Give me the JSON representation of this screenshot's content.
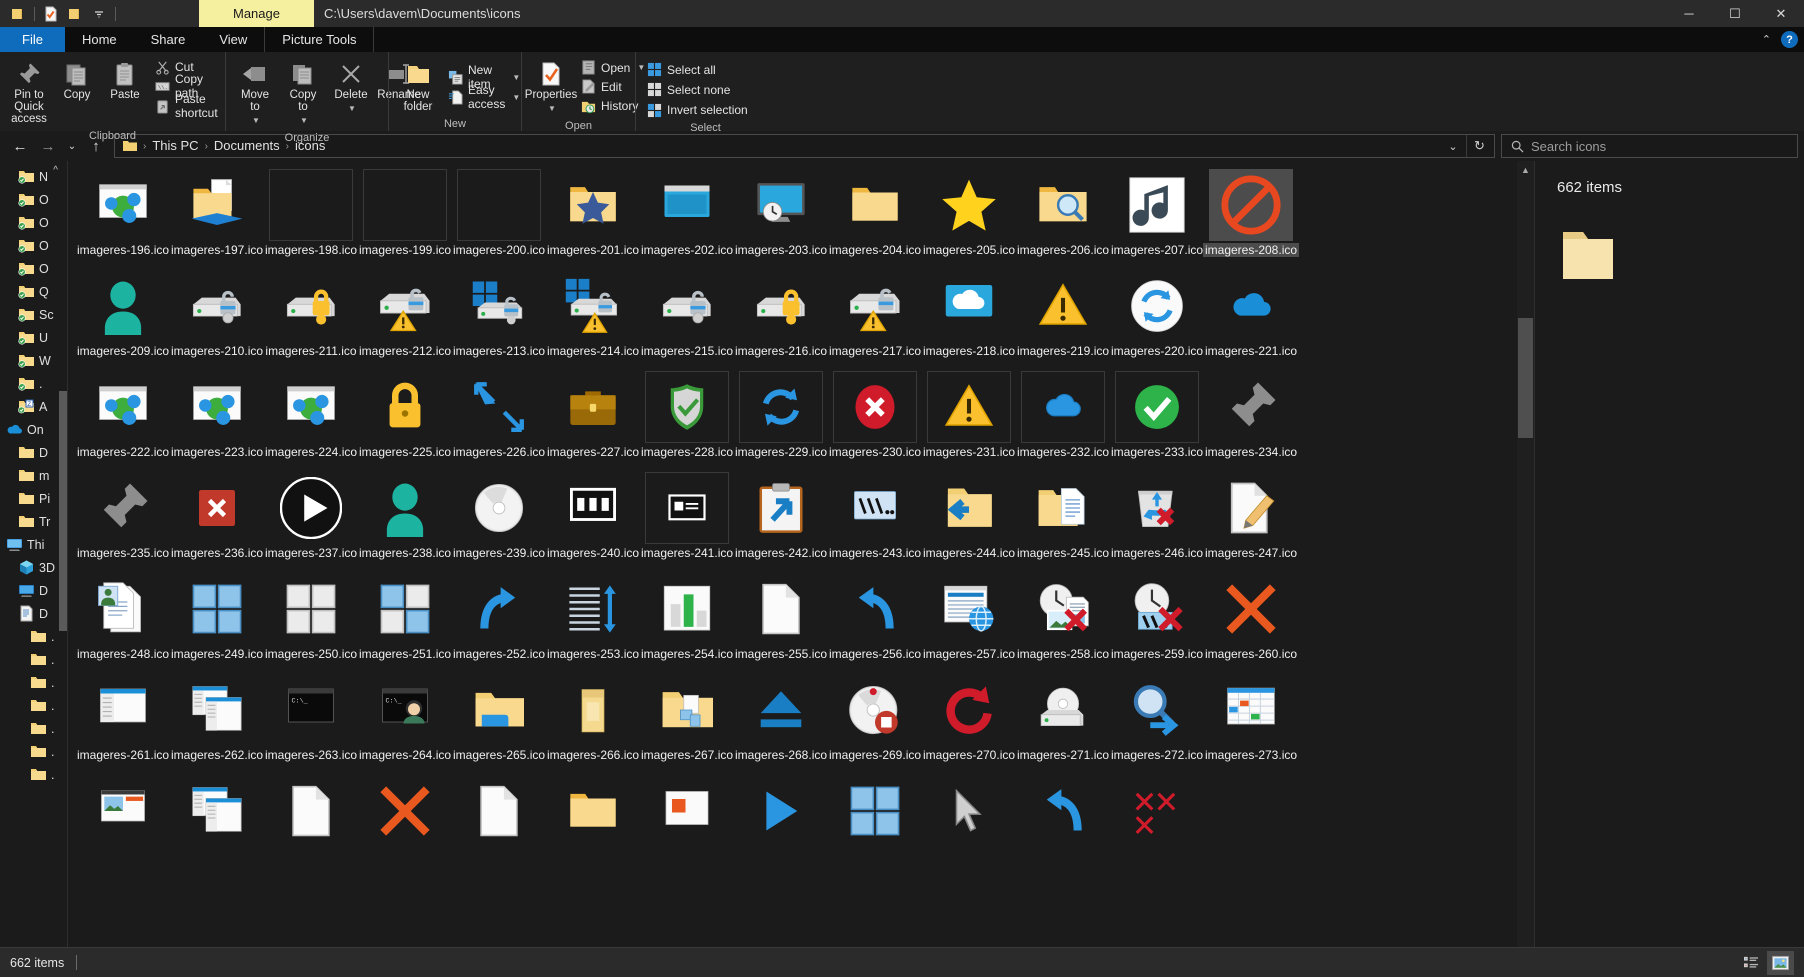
{
  "window": {
    "path_title": "C:\\Users\\davem\\Documents\\icons",
    "manage_tab": "Manage",
    "minimize": "─",
    "maximize": "☐",
    "close": "✕"
  },
  "quick_access": {
    "items": [
      {
        "name": "folder-icon",
        "label": ""
      },
      {
        "name": "properties-icon",
        "label": ""
      },
      {
        "name": "folder-icon",
        "label": ""
      },
      {
        "name": "chevron-down-icon",
        "label": ""
      }
    ]
  },
  "tabs": [
    {
      "id": "file",
      "label": "File"
    },
    {
      "id": "home",
      "label": "Home"
    },
    {
      "id": "share",
      "label": "Share"
    },
    {
      "id": "view",
      "label": "View"
    },
    {
      "id": "picture-tools",
      "label": "Picture Tools"
    }
  ],
  "ribbon": {
    "collapse_caret": "⌃",
    "help": "?",
    "groups": [
      {
        "label": "Clipboard",
        "big": [
          {
            "label": "Pin to Quick\naccess",
            "icon": "pin-icon"
          },
          {
            "label": "Copy",
            "icon": "copy-icon"
          },
          {
            "label": "Paste",
            "icon": "paste-icon"
          }
        ],
        "small": [
          {
            "label": "Cut",
            "icon": "scissors-icon"
          },
          {
            "label": "Copy path",
            "icon": "copy-path-icon"
          },
          {
            "label": "Paste shortcut",
            "icon": "paste-shortcut-icon"
          }
        ]
      },
      {
        "label": "Organize",
        "big": [
          {
            "label": "Move\nto",
            "icon": "move-to-icon",
            "dropdown": true
          },
          {
            "label": "Copy\nto",
            "icon": "copy-to-icon",
            "dropdown": true
          },
          {
            "label": "Delete",
            "icon": "delete-icon",
            "dropdown": true
          },
          {
            "label": "Rename",
            "icon": "rename-icon"
          }
        ],
        "small": []
      },
      {
        "label": "New",
        "big": [
          {
            "label": "New\nfolder",
            "icon": "new-folder-icon"
          }
        ],
        "small": [
          {
            "label": "New item",
            "icon": "new-item-icon",
            "dropdown": true
          },
          {
            "label": "Easy access",
            "icon": "easy-access-icon",
            "dropdown": true
          }
        ]
      },
      {
        "label": "Open",
        "big": [
          {
            "label": "Properties",
            "icon": "properties-icon",
            "dropdown": true
          }
        ],
        "small": [
          {
            "label": "Open",
            "icon": "open-icon",
            "dropdown": true
          },
          {
            "label": "Edit",
            "icon": "edit-icon"
          },
          {
            "label": "History",
            "icon": "history-icon"
          }
        ]
      },
      {
        "label": "Select",
        "big": [],
        "small": [
          {
            "label": "Select all",
            "icon": "select-all-icon"
          },
          {
            "label": "Select none",
            "icon": "select-none-icon"
          },
          {
            "label": "Invert selection",
            "icon": "invert-selection-icon"
          }
        ]
      }
    ]
  },
  "addressbar": {
    "back": "←",
    "forward": "→",
    "recent": "⌄",
    "up": "↑",
    "breadcrumbs": [
      "This PC",
      "Documents",
      "icons"
    ],
    "separator": "›",
    "history_caret": "⌄",
    "refresh": "↻"
  },
  "search": {
    "placeholder": "Search icons",
    "icon": "search-icon"
  },
  "nav_pane": {
    "items": [
      {
        "label": "N",
        "icon": "folder-sync-icon",
        "indent": 1
      },
      {
        "label": "O",
        "icon": "folder-sync-icon",
        "indent": 1
      },
      {
        "label": "O",
        "icon": "folder-sync-icon",
        "indent": 1
      },
      {
        "label": "O",
        "icon": "folder-sync-icon",
        "indent": 1
      },
      {
        "label": "O",
        "icon": "folder-sync-icon",
        "indent": 1
      },
      {
        "label": "Q",
        "icon": "folder-sync-icon",
        "indent": 1
      },
      {
        "label": "Sc",
        "icon": "folder-sync-icon",
        "indent": 1
      },
      {
        "label": "U",
        "icon": "folder-sync-icon",
        "indent": 1
      },
      {
        "label": "W",
        "icon": "folder-sync-icon",
        "indent": 1
      },
      {
        "label": ".",
        "icon": "folder-sync-icon",
        "indent": 1
      },
      {
        "label": "A",
        "icon": "zip-sync-icon",
        "indent": 1
      },
      {
        "label": "On",
        "icon": "onedrive-icon",
        "indent": 0
      },
      {
        "label": "D",
        "icon": "folder-icon",
        "indent": 1
      },
      {
        "label": "m",
        "icon": "folder-icon",
        "indent": 1
      },
      {
        "label": "Pi",
        "icon": "folder-icon",
        "indent": 1
      },
      {
        "label": "Tr",
        "icon": "folder-icon",
        "indent": 1
      },
      {
        "label": "Thi",
        "icon": "this-pc-icon",
        "indent": 0
      },
      {
        "label": "3D",
        "icon": "3d-objects-icon",
        "indent": 1
      },
      {
        "label": "D",
        "icon": "desktop-icon",
        "indent": 1
      },
      {
        "label": "D",
        "icon": "documents-icon",
        "indent": 1
      },
      {
        "label": ".",
        "icon": "folder-icon",
        "indent": 2
      },
      {
        "label": ".",
        "icon": "folder-icon",
        "indent": 2
      },
      {
        "label": ".",
        "icon": "folder-icon",
        "indent": 2
      },
      {
        "label": ".",
        "icon": "folder-icon",
        "indent": 2
      },
      {
        "label": ".",
        "icon": "folder-icon",
        "indent": 2
      },
      {
        "label": ".",
        "icon": "folder-icon",
        "indent": 2
      },
      {
        "label": ".",
        "icon": "folder-icon",
        "indent": 2
      }
    ]
  },
  "detail_pane": {
    "count_text": "662 items",
    "icon": "folder-icon"
  },
  "status_bar": {
    "count_text": "662 items",
    "details_view_icon": "details-view-icon",
    "large-icons_view_icon": "large-icons-view-icon"
  },
  "files": [
    {
      "name": "imageres-196.ico",
      "glyph": "window-people",
      "framed": false
    },
    {
      "name": "imageres-197.ico",
      "glyph": "folder-doc-share",
      "framed": false
    },
    {
      "name": "imageres-198.ico",
      "glyph": "blank",
      "framed": true
    },
    {
      "name": "imageres-199.ico",
      "glyph": "blank",
      "framed": true
    },
    {
      "name": "imageres-200.ico",
      "glyph": "blank",
      "framed": true
    },
    {
      "name": "imageres-201.ico",
      "glyph": "folder-star",
      "framed": false
    },
    {
      "name": "imageres-202.ico",
      "glyph": "window-blue",
      "framed": false
    },
    {
      "name": "imageres-203.ico",
      "glyph": "monitor-clock",
      "framed": false
    },
    {
      "name": "imageres-204.ico",
      "glyph": "folder",
      "framed": false
    },
    {
      "name": "imageres-205.ico",
      "glyph": "star",
      "framed": false
    },
    {
      "name": "imageres-206.ico",
      "glyph": "folder-search",
      "framed": false
    },
    {
      "name": "imageres-207.ico",
      "glyph": "music-note",
      "framed": false
    },
    {
      "name": "imageres-208.ico",
      "glyph": "no-entry",
      "framed": false,
      "selected": true
    },
    {
      "name": "imageres-209.ico",
      "glyph": "person-teal",
      "framed": false
    },
    {
      "name": "imageres-210.ico",
      "glyph": "server-lock-open",
      "framed": false
    },
    {
      "name": "imageres-211.ico",
      "glyph": "server-lock-yellow",
      "framed": false
    },
    {
      "name": "imageres-212.ico",
      "glyph": "server-lock-warn",
      "framed": false
    },
    {
      "name": "imageres-213.ico",
      "glyph": "server-win-lock",
      "framed": false
    },
    {
      "name": "imageres-214.ico",
      "glyph": "server-win-lock-warn",
      "framed": false
    },
    {
      "name": "imageres-215.ico",
      "glyph": "server-lock-open",
      "framed": false
    },
    {
      "name": "imageres-216.ico",
      "glyph": "server-lock-yellow",
      "framed": false
    },
    {
      "name": "imageres-217.ico",
      "glyph": "server-lock-warn",
      "framed": false
    },
    {
      "name": "imageres-218.ico",
      "glyph": "onedrive-cloud-box",
      "framed": false
    },
    {
      "name": "imageres-219.ico",
      "glyph": "warning",
      "framed": false
    },
    {
      "name": "imageres-220.ico",
      "glyph": "sync-circle",
      "framed": false
    },
    {
      "name": "imageres-221.ico",
      "glyph": "onedrive-cloud",
      "framed": false
    },
    {
      "name": "imageres-222.ico",
      "glyph": "window-people",
      "framed": false
    },
    {
      "name": "imageres-223.ico",
      "glyph": "window-people",
      "framed": false
    },
    {
      "name": "imageres-224.ico",
      "glyph": "window-people",
      "framed": false
    },
    {
      "name": "imageres-225.ico",
      "glyph": "padlock-yellow",
      "framed": false
    },
    {
      "name": "imageres-226.ico",
      "glyph": "arrows-in",
      "framed": false
    },
    {
      "name": "imageres-227.ico",
      "glyph": "briefcase",
      "framed": false
    },
    {
      "name": "imageres-228.ico",
      "glyph": "check-shield-gray",
      "framed": true
    },
    {
      "name": "imageres-229.ico",
      "glyph": "sync-arrows",
      "framed": true
    },
    {
      "name": "imageres-230.ico",
      "glyph": "error-x-red",
      "framed": true
    },
    {
      "name": "imageres-231.ico",
      "glyph": "warning",
      "framed": true
    },
    {
      "name": "imageres-232.ico",
      "glyph": "cloud-blue",
      "framed": true
    },
    {
      "name": "imageres-233.ico",
      "glyph": "check-green",
      "framed": true
    },
    {
      "name": "imageres-234.ico",
      "glyph": "pin-gray",
      "framed": false
    },
    {
      "name": "imageres-235.ico",
      "glyph": "pin-gray",
      "framed": false
    },
    {
      "name": "imageres-236.ico",
      "glyph": "x-red-box",
      "framed": false,
      "dark": true
    },
    {
      "name": "imageres-237.ico",
      "glyph": "play-circle",
      "framed": false
    },
    {
      "name": "imageres-238.ico",
      "glyph": "person-teal",
      "framed": false
    },
    {
      "name": "imageres-239.ico",
      "glyph": "disc",
      "framed": false
    },
    {
      "name": "imageres-240.ico",
      "glyph": "tiles-view",
      "framed": false
    },
    {
      "name": "imageres-241.ico",
      "glyph": "content-view",
      "framed": true
    },
    {
      "name": "imageres-242.ico",
      "glyph": "clipboard-arrow",
      "framed": false
    },
    {
      "name": "imageres-243.ico",
      "glyph": "unc-path",
      "framed": false
    },
    {
      "name": "imageres-244.ico",
      "glyph": "folder-arrow-left",
      "framed": false
    },
    {
      "name": "imageres-245.ico",
      "glyph": "folder-docs",
      "framed": false
    },
    {
      "name": "imageres-246.ico",
      "glyph": "recycle-x",
      "framed": false
    },
    {
      "name": "imageres-247.ico",
      "glyph": "doc-pencil",
      "framed": false
    },
    {
      "name": "imageres-248.ico",
      "glyph": "docs-person",
      "framed": false
    },
    {
      "name": "imageres-249.ico",
      "glyph": "tiles-blue",
      "framed": false
    },
    {
      "name": "imageres-250.ico",
      "glyph": "tiles-gray",
      "framed": false
    },
    {
      "name": "imageres-251.ico",
      "glyph": "tiles-mixed",
      "framed": false
    },
    {
      "name": "imageres-252.ico",
      "glyph": "redo-arrow",
      "framed": false
    },
    {
      "name": "imageres-253.ico",
      "glyph": "list-arrows",
      "framed": false
    },
    {
      "name": "imageres-254.ico",
      "glyph": "chart-bars",
      "framed": false
    },
    {
      "name": "imageres-255.ico",
      "glyph": "doc-blank",
      "framed": false
    },
    {
      "name": "imageres-256.ico",
      "glyph": "undo-arrow",
      "framed": false
    },
    {
      "name": "imageres-257.ico",
      "glyph": "window-globe",
      "framed": false
    },
    {
      "name": "imageres-258.ico",
      "glyph": "clock-photo-x",
      "framed": false
    },
    {
      "name": "imageres-259.ico",
      "glyph": "clock-unc-x",
      "framed": false
    },
    {
      "name": "imageres-260.ico",
      "glyph": "x-orange",
      "framed": false
    },
    {
      "name": "imageres-261.ico",
      "glyph": "explorer-window",
      "framed": false
    },
    {
      "name": "imageres-262.ico",
      "glyph": "explorer-windows2",
      "framed": false
    },
    {
      "name": "imageres-263.ico",
      "glyph": "console",
      "framed": false
    },
    {
      "name": "imageres-264.ico",
      "glyph": "console-person",
      "framed": false
    },
    {
      "name": "imageres-265.ico",
      "glyph": "folder-blue-tab",
      "framed": false
    },
    {
      "name": "imageres-266.ico",
      "glyph": "usb-drive",
      "framed": false
    },
    {
      "name": "imageres-267.ico",
      "glyph": "folder-share-puzzle",
      "framed": false
    },
    {
      "name": "imageres-268.ico",
      "glyph": "eject",
      "framed": false
    },
    {
      "name": "imageres-269.ico",
      "glyph": "disc-record-stop",
      "framed": false
    },
    {
      "name": "imageres-270.ico",
      "glyph": "refresh-red",
      "framed": false
    },
    {
      "name": "imageres-271.ico",
      "glyph": "drive-gray",
      "framed": false
    },
    {
      "name": "imageres-272.ico",
      "glyph": "search-arrow",
      "framed": false
    },
    {
      "name": "imageres-273.ico",
      "glyph": "spreadsheet",
      "framed": false
    },
    {
      "name": "",
      "glyph": "photo-window",
      "framed": false
    },
    {
      "name": "",
      "glyph": "explorer-windows2",
      "framed": false
    },
    {
      "name": "",
      "glyph": "doc-blank",
      "framed": false
    },
    {
      "name": "",
      "glyph": "x-orange",
      "framed": false
    },
    {
      "name": "",
      "glyph": "doc-blank",
      "framed": false
    },
    {
      "name": "",
      "glyph": "folder",
      "framed": false
    },
    {
      "name": "",
      "glyph": "orange-square",
      "framed": false
    },
    {
      "name": "",
      "glyph": "play-blue",
      "framed": false
    },
    {
      "name": "",
      "glyph": "tiles-blue",
      "framed": false
    },
    {
      "name": "",
      "glyph": "cursor-arrow",
      "framed": false
    },
    {
      "name": "",
      "glyph": "undo-arrow",
      "framed": false
    },
    {
      "name": "",
      "glyph": "red-lines",
      "framed": false
    }
  ]
}
